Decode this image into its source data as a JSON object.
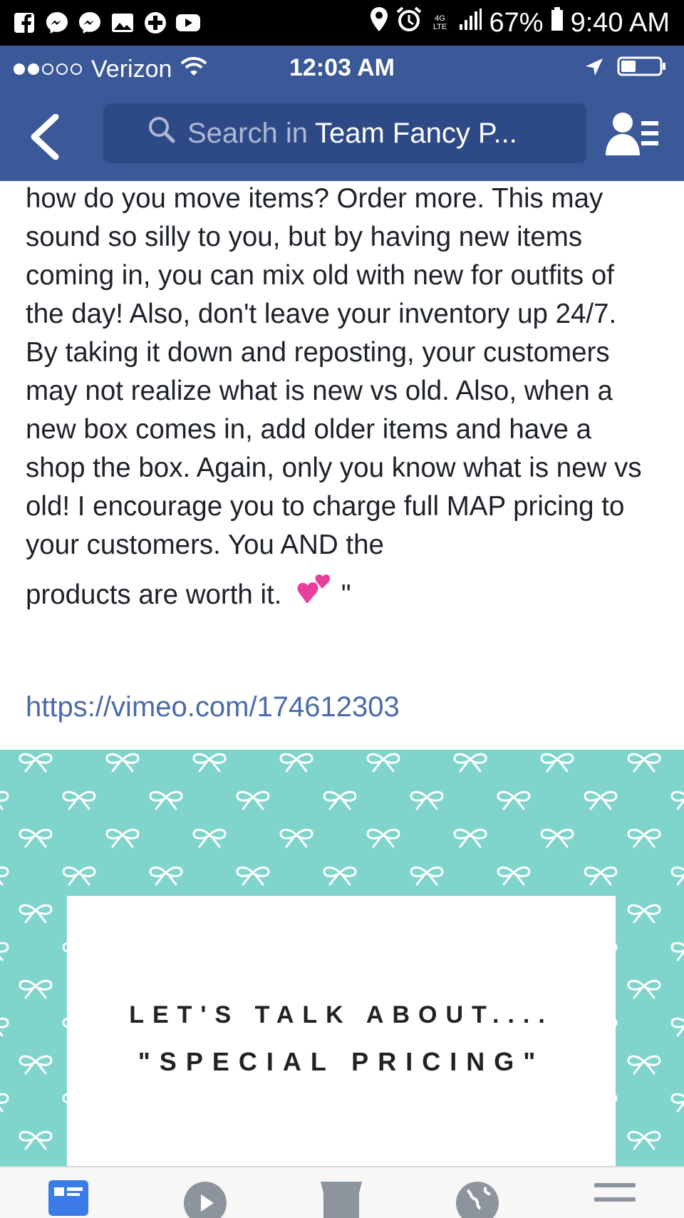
{
  "android_status": {
    "battery": "67%",
    "time": "9:40 AM",
    "network": "4G LTE",
    "icons": [
      "facebook-icon",
      "messenger-icon",
      "messenger-icon",
      "gallery-icon",
      "plus-icon",
      "youtube-icon",
      "location-icon",
      "alarm-icon",
      "lte-icon",
      "signal-icon",
      "battery-icon"
    ]
  },
  "ios_status": {
    "carrier": "Verizon",
    "time": "12:03 AM",
    "icons": [
      "signal-dots-icon",
      "wifi-icon",
      "location-arrow-icon",
      "battery-icon"
    ]
  },
  "nav": {
    "search_placeholder": "Search in",
    "group_name": "Team Fancy P...",
    "icons": [
      "back-chevron-icon",
      "search-icon",
      "members-icon"
    ]
  },
  "post": {
    "text": "how do you move items? Order more. This may sound so silly to you, but by having new items coming in, you can mix old with new for outfits of the day! Also, don't leave your inventory up 24/7. By taking it down and reposting, your customers may not realize what is new vs old. Also, when a new box comes in, add older items and have a shop the box. Again, only you know what is new vs old! I encourage you to charge full MAP pricing to your customers. You AND the",
    "last_line": "products are worth it.",
    "closing_quote": "\"",
    "link": "https://vimeo.com/174612303"
  },
  "image": {
    "line1": "LET'S TALK ABOUT....",
    "line2": "\"SPECIAL PRICING\"",
    "colors": {
      "background": "#7fd4cc",
      "bow": "#ffffff",
      "card": "#ffffff"
    }
  },
  "tabbar": {
    "icons": [
      "news-feed-icon",
      "video-icon",
      "marketplace-icon",
      "globe-icon",
      "menu-icon"
    ],
    "active": "news-feed-icon"
  },
  "colors": {
    "facebook_blue": "#3b5998",
    "link": "#4b6ba8",
    "text": "#1d2129"
  }
}
